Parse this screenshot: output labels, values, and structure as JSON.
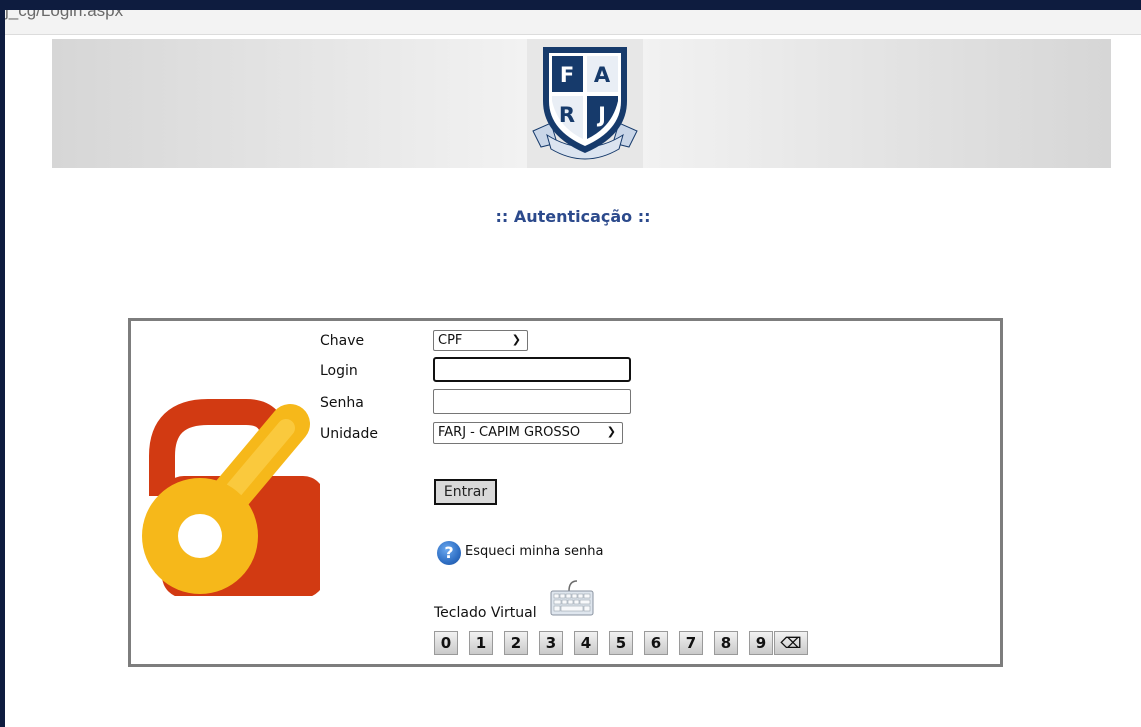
{
  "browser": {
    "url_fragment": "j_cg/Login.aspx"
  },
  "header": {
    "logo_letters": [
      "F",
      "A",
      "R",
      "J"
    ],
    "logo_ribbon_text": "EDUCARE ET RECREARE"
  },
  "page": {
    "title": ":: Autenticação ::"
  },
  "form": {
    "chave_label": "Chave",
    "chave_value": "CPF",
    "login_label": "Login",
    "login_value": "",
    "senha_label": "Senha",
    "senha_value": "",
    "unidade_label": "Unidade",
    "unidade_value": "FARJ - CAPIM GROSSO",
    "submit_label": "Entrar",
    "forgot_label": "Esqueci minha senha",
    "forgot_icon_glyph": "?",
    "virtual_keyboard_label": "Teclado Virtual",
    "keys": [
      "0",
      "1",
      "2",
      "3",
      "4",
      "5",
      "6",
      "7",
      "8",
      "9"
    ],
    "backspace_glyph": "⌫"
  },
  "colors": {
    "accent_title": "#2c4a8c",
    "lock_body": "#d23a12",
    "key_yellow": "#f6b81a",
    "window_frame": "#0e1c3f"
  }
}
